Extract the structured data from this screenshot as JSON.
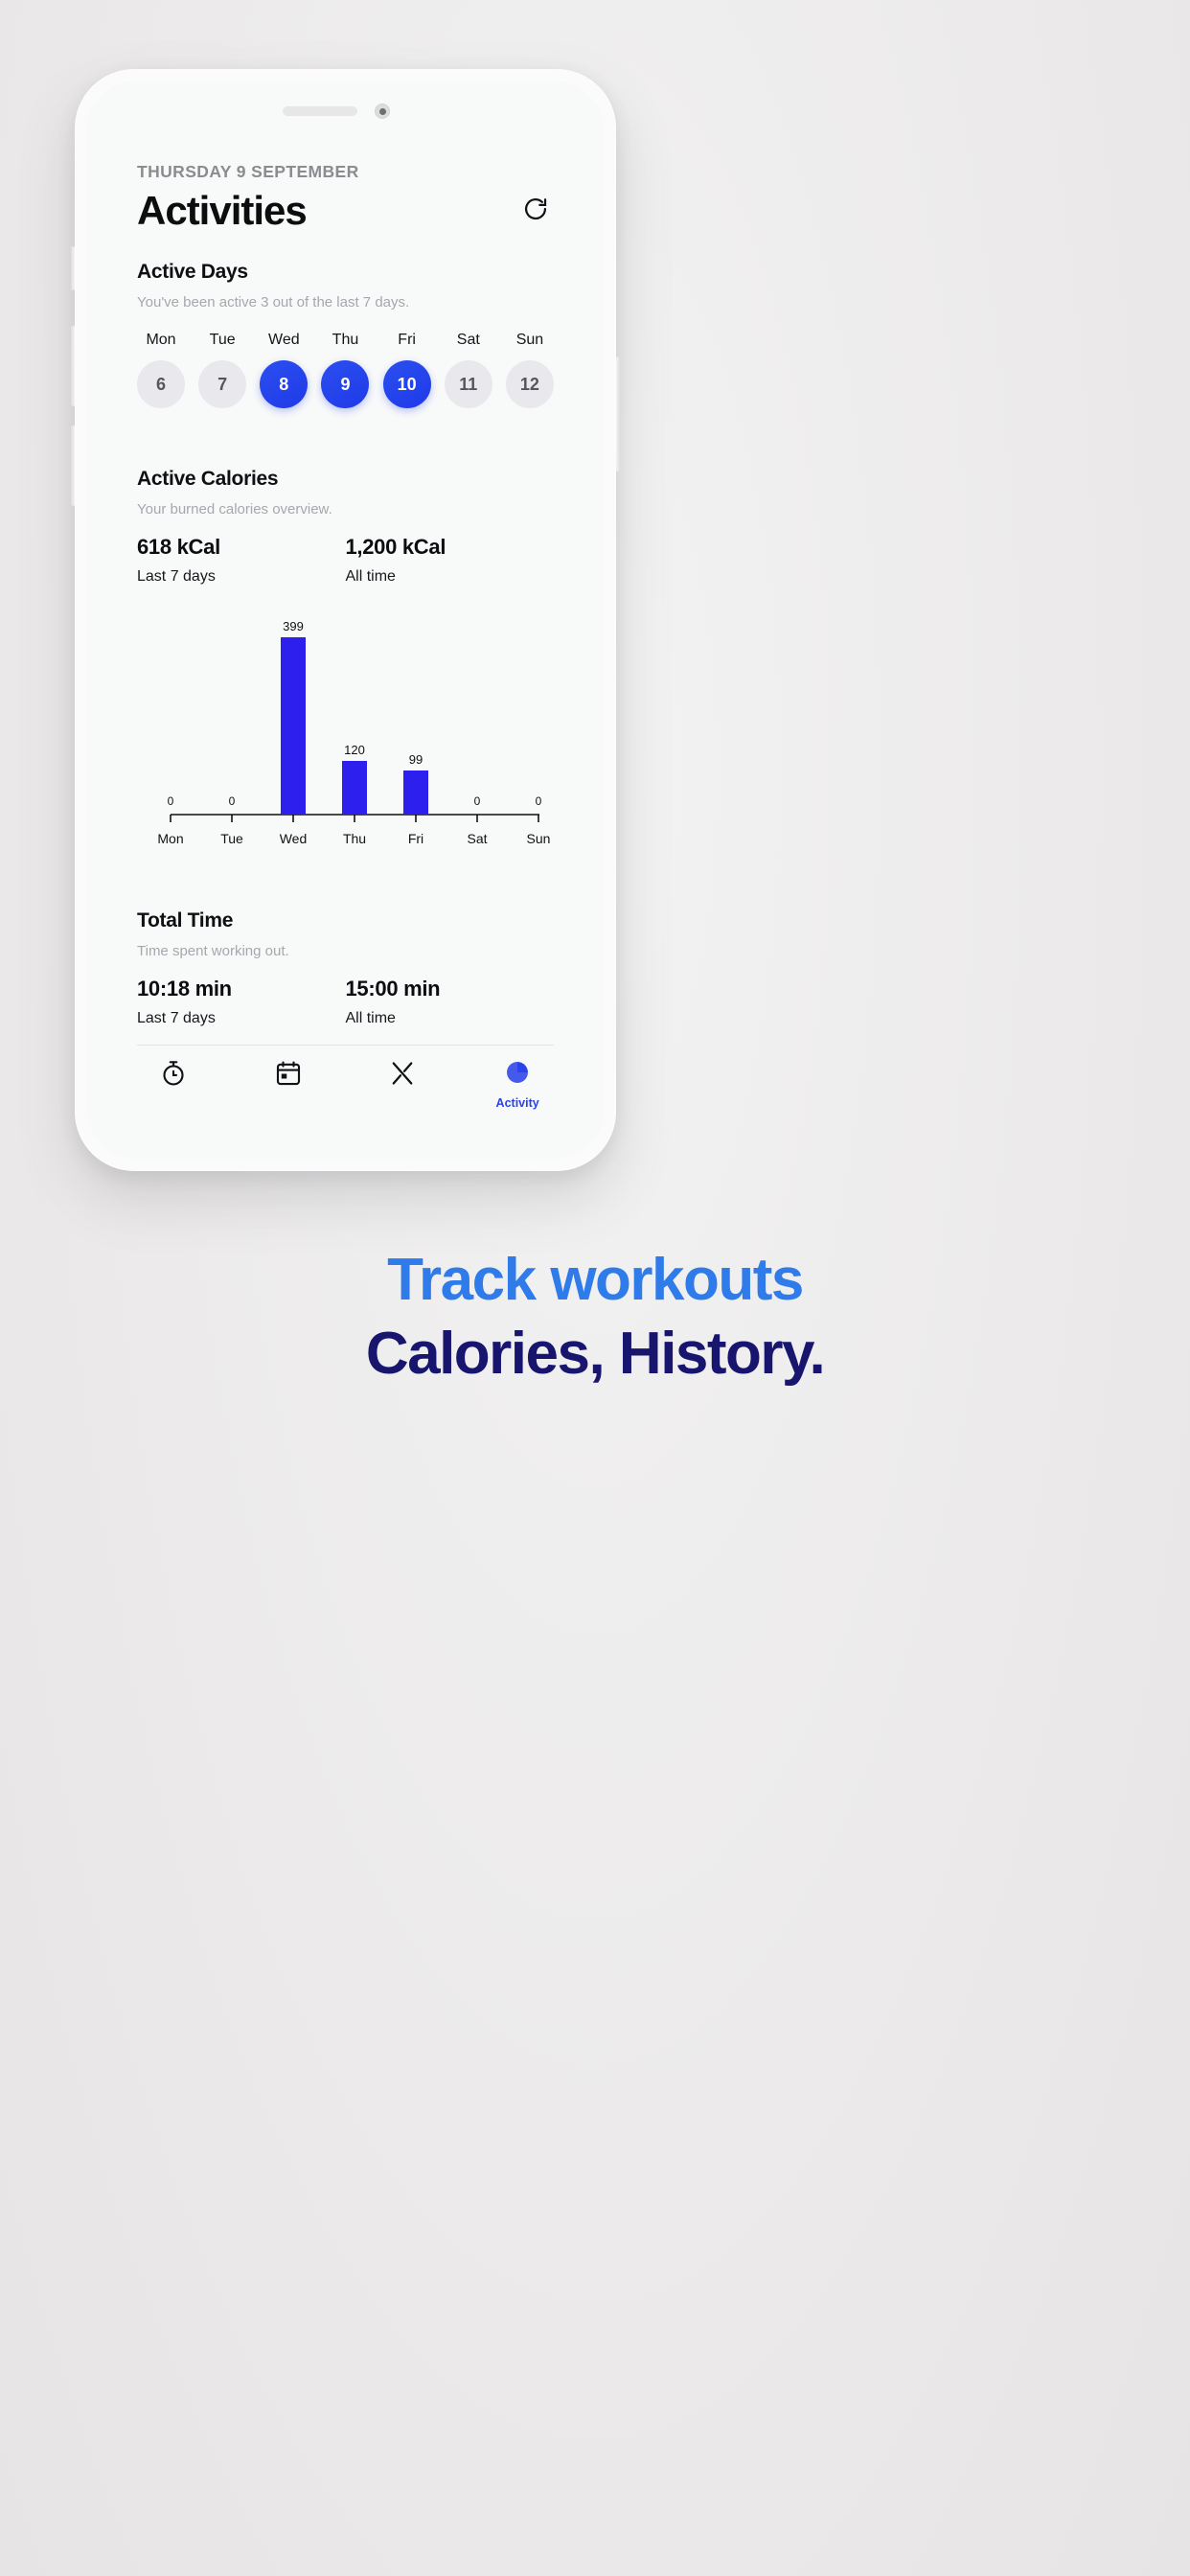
{
  "app": {
    "date_label": "THURSDAY 9 SEPTEMBER",
    "title": "Activities",
    "refresh_icon": "refresh-icon"
  },
  "active_days": {
    "heading": "Active Days",
    "subtitle": "You've been active 3 out of the last 7 days.",
    "days": [
      {
        "name": "Mon",
        "date": "6",
        "active": false
      },
      {
        "name": "Tue",
        "date": "7",
        "active": false
      },
      {
        "name": "Wed",
        "date": "8",
        "active": true
      },
      {
        "name": "Thu",
        "date": "9",
        "active": true
      },
      {
        "name": "Fri",
        "date": "10",
        "active": true
      },
      {
        "name": "Sat",
        "date": "11",
        "active": false
      },
      {
        "name": "Sun",
        "date": "12",
        "active": false
      }
    ]
  },
  "active_calories": {
    "heading": "Active Calories",
    "subtitle": "Your burned calories overview.",
    "stats": [
      {
        "value": "618 kCal",
        "label": "Last 7 days"
      },
      {
        "value": "1,200 kCal",
        "label": "All time"
      }
    ]
  },
  "total_time": {
    "heading": "Total Time",
    "subtitle": "Time spent working out.",
    "stats": [
      {
        "value": "10:18 min",
        "label": "Last 7 days"
      },
      {
        "value": "15:00 min",
        "label": "All time"
      }
    ]
  },
  "tabbar": {
    "items": [
      {
        "icon": "stopwatch-icon",
        "label": "",
        "active": false
      },
      {
        "icon": "calendar-icon",
        "label": "",
        "active": false
      },
      {
        "icon": "cutlery-icon",
        "label": "",
        "active": false
      },
      {
        "icon": "pie-chart-icon",
        "label": "Activity",
        "active": true
      }
    ]
  },
  "promo": {
    "line1": "Track workouts",
    "line2": "Calories, History."
  },
  "colors": {
    "accent": "#2b43e8",
    "bar": "#2d20ee",
    "promo_top": "#2f7bea",
    "promo_bottom": "#17156e",
    "muted": "#a7a7ae"
  },
  "chart_data": {
    "type": "bar",
    "title": "Active Calories",
    "categories": [
      "Mon",
      "Tue",
      "Wed",
      "Thu",
      "Fri",
      "Sat",
      "Sun"
    ],
    "values": [
      0,
      0,
      399,
      120,
      99,
      0,
      0
    ],
    "data_labels": [
      "0",
      "0",
      "399",
      "120",
      "99",
      "0",
      "0"
    ],
    "xlabel": "",
    "ylabel": "",
    "ylim": [
      0,
      399
    ],
    "grid": false,
    "legend": false,
    "bar_color": "#2d20ee",
    "axis_color": "#111111"
  }
}
